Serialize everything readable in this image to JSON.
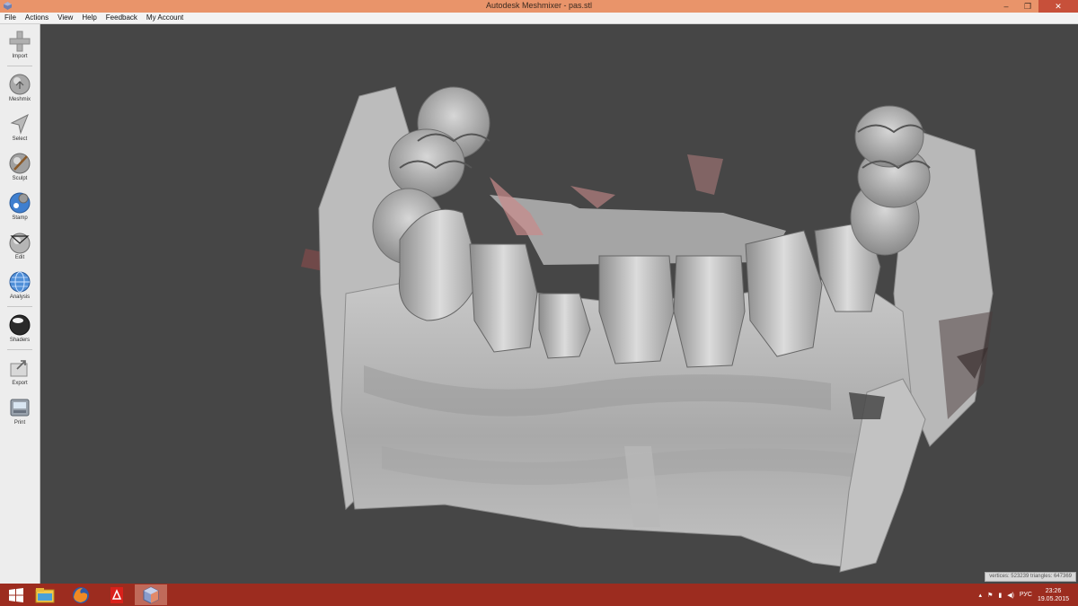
{
  "window": {
    "title": "Autodesk Meshmixer - pas.stl",
    "app_icon": "meshmixer-icon",
    "min_symbol": "–",
    "max_symbol": "❐",
    "close_symbol": "✕"
  },
  "menu": [
    {
      "label": "File"
    },
    {
      "label": "Actions"
    },
    {
      "label": "View"
    },
    {
      "label": "Help"
    },
    {
      "label": "Feedback"
    },
    {
      "label": "My Account"
    }
  ],
  "tools": [
    {
      "label": "Import",
      "icon": "plus-icon"
    },
    {
      "label": "Meshmix",
      "icon": "meshmix-sphere-icon"
    },
    {
      "label": "Select",
      "icon": "arrow-cursor-icon"
    },
    {
      "label": "Sculpt",
      "icon": "brush-icon"
    },
    {
      "label": "Stamp",
      "icon": "stamp-icon"
    },
    {
      "label": "Edit",
      "icon": "edit-mesh-icon"
    },
    {
      "label": "Analysis",
      "icon": "analysis-globe-icon"
    },
    {
      "label": "Shaders",
      "icon": "shader-sphere-icon"
    },
    {
      "label": "Export",
      "icon": "export-icon"
    },
    {
      "label": "Print",
      "icon": "printer-icon"
    }
  ],
  "stats": {
    "text": "vertices: 523239 triangles: 647369"
  },
  "taskbar": {
    "apps": [
      {
        "name": "start-button",
        "icon": "windows-logo-icon"
      },
      {
        "name": "file-explorer",
        "icon": "folder-icon"
      },
      {
        "name": "firefox",
        "icon": "firefox-icon"
      },
      {
        "name": "pdf-reader",
        "icon": "pdf-icon"
      },
      {
        "name": "meshmixer",
        "icon": "meshmixer-icon"
      }
    ],
    "language": "РУС",
    "time": "23:26",
    "date": "19.05.2015"
  },
  "colors": {
    "titlebar": "#e9946a",
    "taskbar": "#9c2c1f",
    "viewport_bg": "#464646",
    "mesh": "#bdbdbd",
    "mesh_tint": "#c98a8a"
  }
}
